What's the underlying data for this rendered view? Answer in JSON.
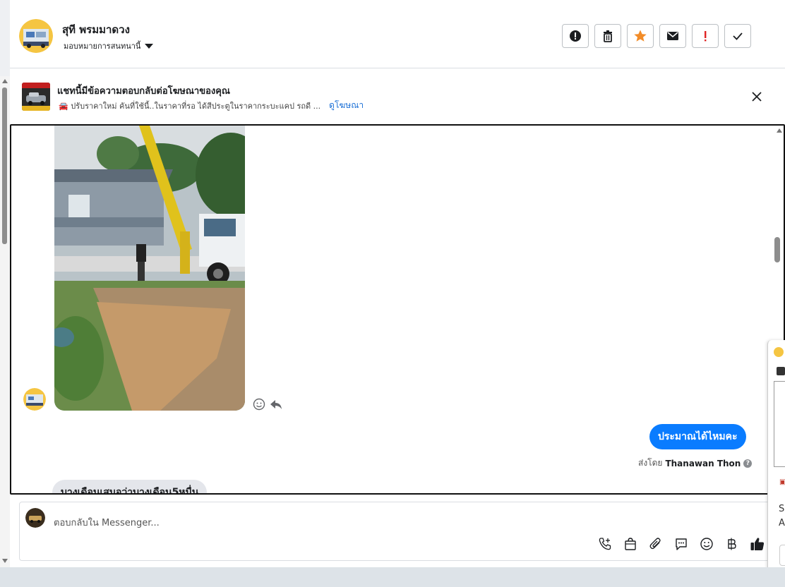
{
  "header": {
    "name": "สุที พรมมาดวง",
    "assign_label": "มอบหมายการสนทนานี้",
    "actions": [
      {
        "icon": "alert-circle-icon",
        "label": "spam"
      },
      {
        "icon": "trash-icon",
        "label": "delete"
      },
      {
        "icon": "star-icon",
        "label": "follow-up"
      },
      {
        "icon": "envelope-icon",
        "label": "mark-unread"
      },
      {
        "icon": "exclamation-icon",
        "label": "priority"
      },
      {
        "icon": "check-icon",
        "label": "done"
      }
    ]
  },
  "ad_banner": {
    "title": "แชทนี้มีข้อความตอบกลับต่อโฆษณาของคุณ",
    "description": "🚘 ปรับราคาใหม่ คันที่ใช้นี้..ในราคาที่รอ ได้สีประตูในราคากระบะแคป รถดี ...",
    "link": "ดูโฆษณา"
  },
  "messages": {
    "outgoing_text": "ประมาณได้ไหมคะ",
    "sent_by_prefix": "ส่งโดย",
    "sent_by_name": "Thanawan Thon",
    "incoming_text": "บางเดือนเสมอว่าบางเดือน5หมื่น"
  },
  "composer": {
    "placeholder": "ตอบกลับใน Messenger..."
  },
  "popup": {
    "text1": "Se",
    "text2": "A"
  },
  "colors": {
    "accent": "#0a7cff",
    "star": "#f28c28",
    "priority": "#e02424"
  }
}
